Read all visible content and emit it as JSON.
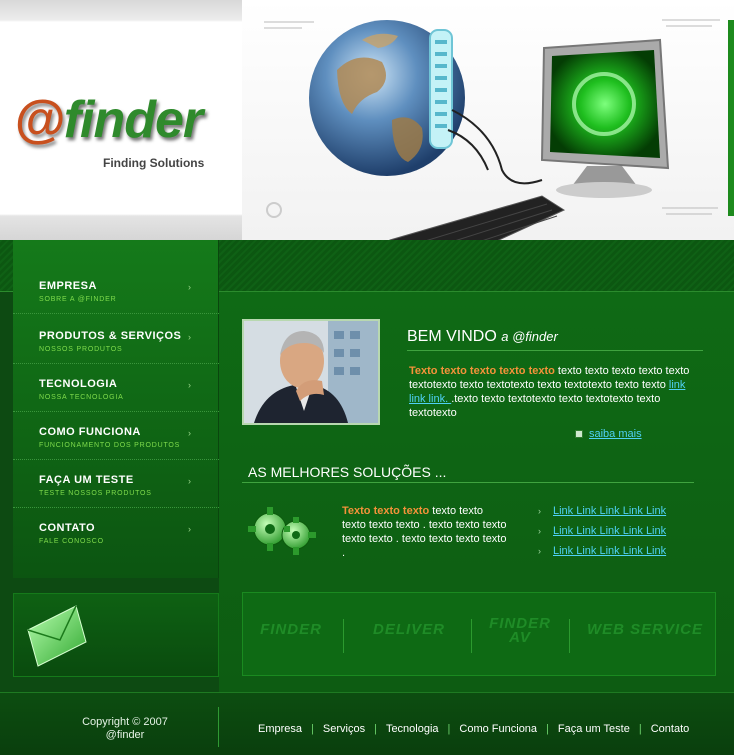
{
  "header": {
    "logo_at": "@",
    "logo_word": "finder",
    "logo_sub": "Finding Solutions"
  },
  "nav": {
    "items": [
      {
        "title": "EMPRESA",
        "sub": "SOBRE A @FINDER"
      },
      {
        "title": "PRODUTOS & SERVIÇOS",
        "sub": "NOSSOS PRODUTOS"
      },
      {
        "title": "TECNOLOGIA",
        "sub": "NOSSA TECNOLOGIA"
      },
      {
        "title": "COMO FUNCIONA",
        "sub": "FUNCIONAMENTO DOS PRODUTOS"
      },
      {
        "title": "FAÇA UM TESTE",
        "sub": "TESTE NOSSOS PRODUTOS"
      },
      {
        "title": "CONTATO",
        "sub": "FALE CONOSCO"
      }
    ],
    "arrow": "›"
  },
  "welcome": {
    "big": "BEM VINDO",
    "small": "a @finder"
  },
  "intro": {
    "highlight": "Texto texto texto texto texto",
    "text1": " texto texto texto texto texto textotexto texto textotexto texto textotexto texto texto ",
    "link": "link link link. ",
    "text2": ".texto texto textotexto texto textotexto texto textotexto"
  },
  "saiba": "saiba mais",
  "solucoes_title": "AS MELHORES SOLUÇÕES ...",
  "solutions": {
    "highlight": "Texto texto texto",
    "text": " texto texto texto texto texto . texto texto texto texto texto . texto texto texto texto ."
  },
  "links": [
    "Link Link Link Link Link",
    "Link Link Link Link Link",
    "Link Link Link Link Link"
  ],
  "link_bullet": "›",
  "partners": [
    "FINDER",
    "DELIVER",
    "FINDER AV",
    "WEB SERVICE"
  ],
  "footer": {
    "copyright_line1": "Copyright © 2007",
    "copyright_line2": "@finder",
    "nav": [
      "Empresa",
      "Serviços",
      "Tecnologia",
      "Como Funciona",
      "Faça um Teste",
      "Contato"
    ],
    "separator": "|"
  },
  "colors": {
    "accent_orange": "#f4923a",
    "link_blue": "#4fd1f5",
    "green_dark": "#0d4a12",
    "green_mid": "#0f6a15"
  }
}
